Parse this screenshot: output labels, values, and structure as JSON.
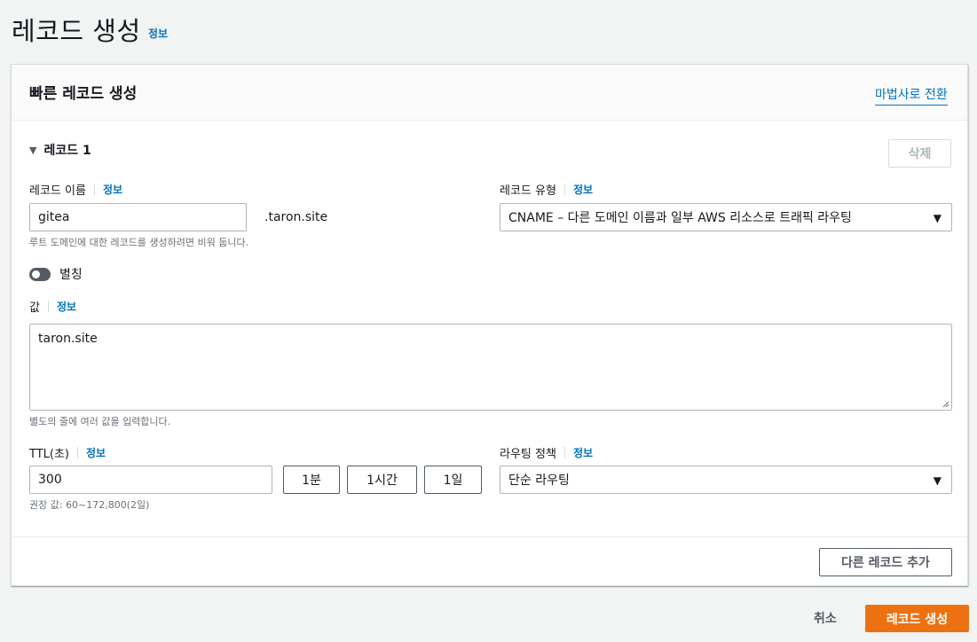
{
  "page": {
    "title": "레코드 생성",
    "info_link": "정보"
  },
  "card": {
    "title": "빠른 레코드 생성",
    "wizard_link": "마법사로 전환",
    "record_section": {
      "toggle_label": "레코드 1",
      "delete_button": "삭제"
    },
    "record_name": {
      "label": "레코드 이름",
      "info": "정보",
      "value": "gitea",
      "domain_suffix": ".taron.site",
      "hint": "루트 도메인에 대한 레코드를 생성하려면 비워 둡니다."
    },
    "record_type": {
      "label": "레코드 유형",
      "info": "정보",
      "selected": "CNAME – 다른 도메인 이름과 일부 AWS 리소스로 트래픽 라우팅"
    },
    "alias": {
      "label": "별칭",
      "enabled": false
    },
    "value": {
      "label": "값",
      "info": "정보",
      "text": "taron.site",
      "hint": "별도의 줄에 여러 값을 입력합니다."
    },
    "ttl": {
      "label": "TTL(초)",
      "info": "정보",
      "value": "300",
      "preset_1m": "1분",
      "preset_1h": "1시간",
      "preset_1d": "1일",
      "hint": "권장 값: 60~172,800(2일)"
    },
    "routing_policy": {
      "label": "라우팅 정책",
      "info": "정보",
      "selected": "단순 라우팅"
    },
    "add_record_button": "다른 레코드 추가"
  },
  "actions": {
    "cancel": "취소",
    "create": "레코드 생성"
  },
  "colors": {
    "link": "#0073bb",
    "primary": "#ec7211",
    "background": "#f2f3f3"
  }
}
